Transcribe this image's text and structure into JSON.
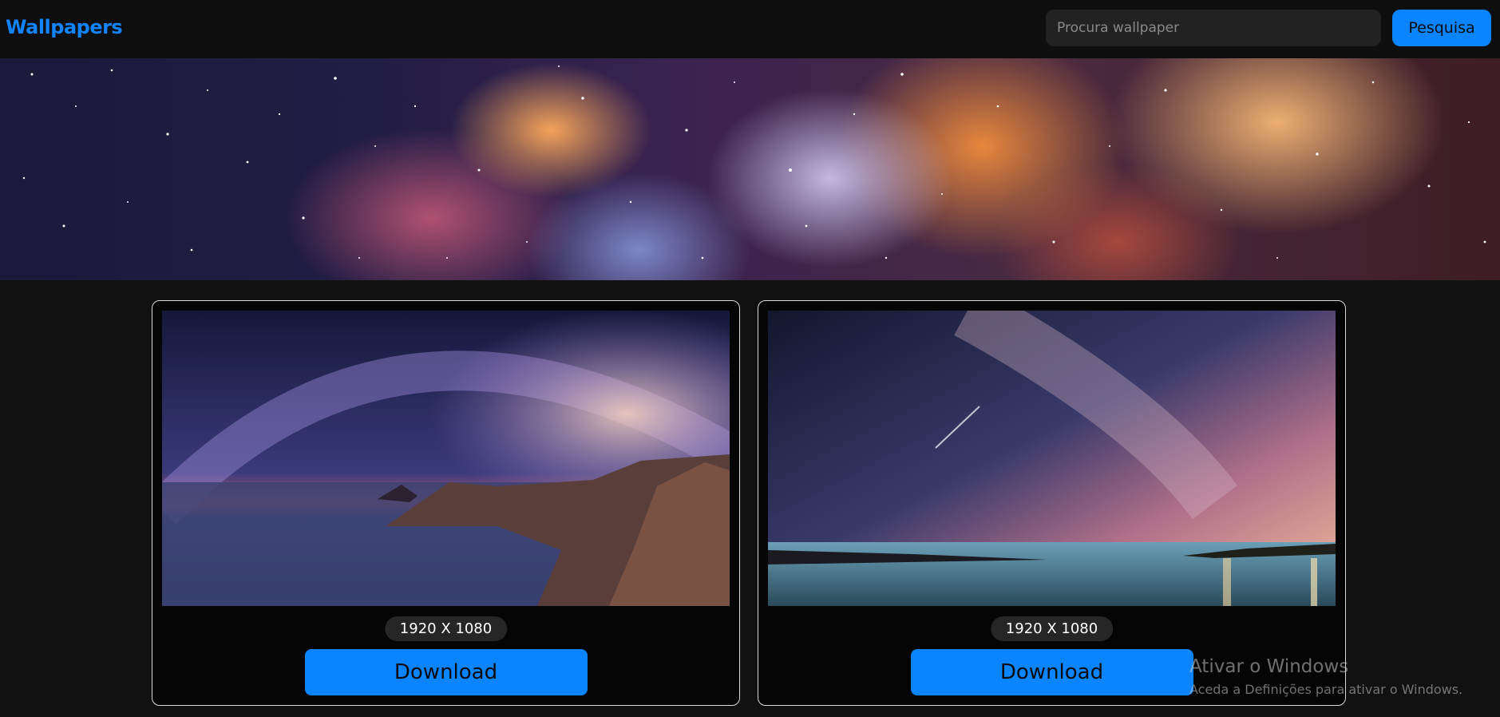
{
  "navbar": {
    "brand": "Wallpapers",
    "search_placeholder": "Procura wallpaper",
    "search_value": "",
    "search_button": "Pesquisa"
  },
  "hero": {
    "alt": "nebula banner"
  },
  "cards": [
    {
      "resolution": "1920 X 1080",
      "download_label": "Download"
    },
    {
      "resolution": "1920 X 1080",
      "download_label": "Download"
    }
  ],
  "watermark": {
    "title": "Ativar o Windows",
    "subtitle": "Aceda a Definições para ativar o Windows."
  },
  "colors": {
    "accent": "#0a84ff",
    "brand": "#1384ff",
    "background": "#111111"
  }
}
